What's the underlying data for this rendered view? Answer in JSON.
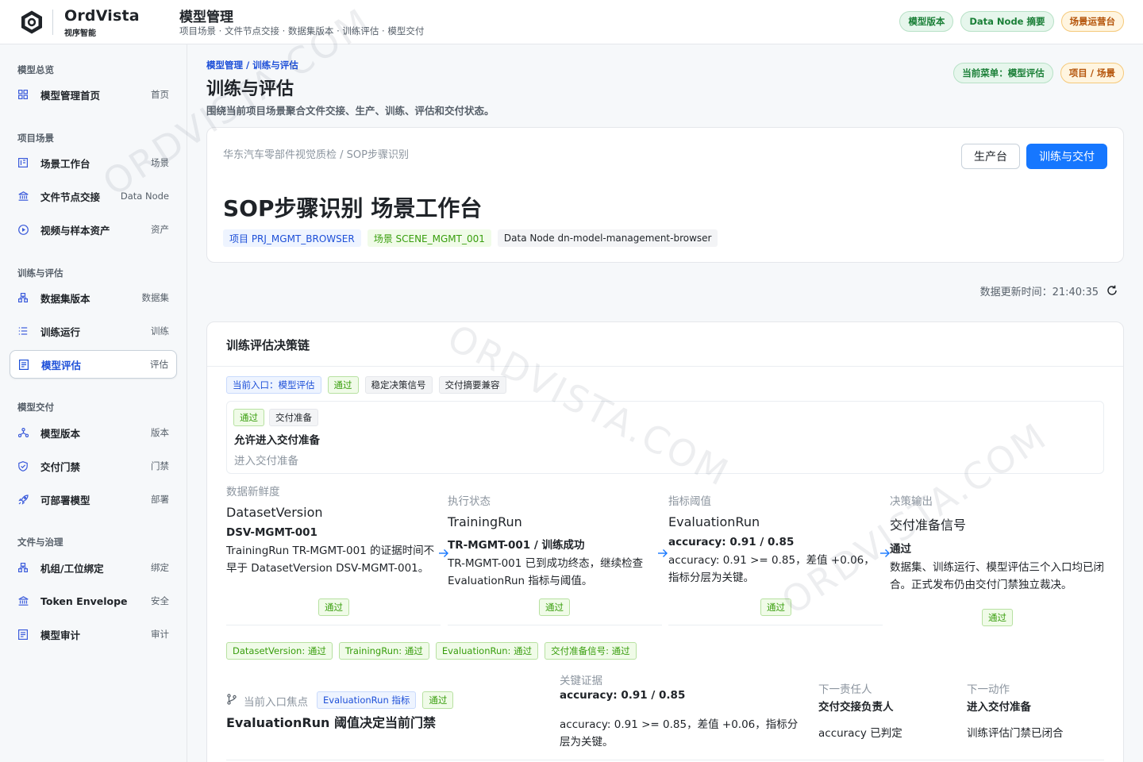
{
  "brand": {
    "name": "OrdVista",
    "subtitle": "视序智能"
  },
  "app": {
    "title": "模型管理",
    "subtitle": "项目场景 · 文件节点交接 · 数据集版本 · 训练评估 · 模型交付"
  },
  "top_pills": [
    "模型版本",
    "Data Node 摘要",
    "场景运营台"
  ],
  "sidebar": {
    "groups": [
      {
        "label": "模型总览",
        "items": [
          {
            "label": "模型管理首页",
            "tag": "首页",
            "icon": "grid-icon"
          }
        ]
      },
      {
        "label": "项目场景",
        "items": [
          {
            "label": "场景工作台",
            "tag": "场景",
            "icon": "workbench-icon"
          },
          {
            "label": "文件节点交接",
            "tag": "Data Node",
            "icon": "bank-icon"
          },
          {
            "label": "视频与样本资产",
            "tag": "资产",
            "icon": "play-circle-icon"
          }
        ]
      },
      {
        "label": "训练与评估",
        "items": [
          {
            "label": "数据集版本",
            "tag": "数据集",
            "icon": "dataset-icon"
          },
          {
            "label": "训练运行",
            "tag": "训练",
            "icon": "list-icon"
          },
          {
            "label": "模型评估",
            "tag": "评估",
            "icon": "evaluation-icon",
            "active": true
          }
        ]
      },
      {
        "label": "模型交付",
        "items": [
          {
            "label": "模型版本",
            "tag": "版本",
            "icon": "cluster-icon"
          },
          {
            "label": "交付门禁",
            "tag": "门禁",
            "icon": "shield-icon"
          },
          {
            "label": "可部署模型",
            "tag": "部署",
            "icon": "rocket-icon"
          }
        ]
      },
      {
        "label": "文件与治理",
        "items": [
          {
            "label": "机组/工位绑定",
            "tag": "绑定",
            "icon": "station-icon"
          },
          {
            "label": "Token Envelope",
            "tag": "安全",
            "icon": "bank-icon"
          },
          {
            "label": "模型审计",
            "tag": "审计",
            "icon": "audit-icon"
          }
        ]
      }
    ]
  },
  "page": {
    "breadcrumb": "模型管理 / 训练与评估",
    "title": "训练与评估",
    "description": "围绕当前项目场景聚合文件交接、生产、训练、评估和交付状态。",
    "pills": [
      "当前菜单：模型评估",
      "项目 / 场景"
    ]
  },
  "scene": {
    "path": "华东汽车零部件视觉质检 / SOP步骤识别",
    "title": "SOP步骤识别 场景工作台",
    "buttons": {
      "production": "生产台",
      "train_deliver": "训练与交付"
    },
    "tags": [
      "项目 PRJ_MGMT_BROWSER",
      "场景 SCENE_MGMT_001",
      "Data Node dn-model-management-browser"
    ]
  },
  "update": {
    "label": "数据更新时间：",
    "time": "21:40:35"
  },
  "chain": {
    "title": "训练评估决策链",
    "chips": [
      "当前入口：模型评估",
      "通过",
      "稳定决策信号",
      "交付摘要兼容"
    ],
    "allow": {
      "chips": [
        "通过",
        "交付准备"
      ],
      "title": "允许进入交付准备",
      "subtitle": "进入交付准备"
    },
    "stages": [
      {
        "label": "数据新鲜度",
        "name": "DatasetVersion",
        "id": "DSV-MGMT-001",
        "desc": "TrainingRun TR-MGMT-001 的证据时间不早于 DatasetVersion DSV-MGMT-001。",
        "status": "通过"
      },
      {
        "label": "执行状态",
        "name": "TrainingRun",
        "id": "TR-MGMT-001 / 训练成功",
        "desc": "TR-MGMT-001 已到成功终态，继续检查 EvaluationRun 指标与阈值。",
        "status": "通过"
      },
      {
        "label": "指标阈值",
        "name": "EvaluationRun",
        "id": "accuracy: 0.91 / 0.85",
        "desc": "accuracy: 0.91 >= 0.85，差值 +0.06，指标分层为关键。",
        "status": "通过"
      },
      {
        "label": "决策输出",
        "name": "交付准备信号",
        "id": "通过",
        "desc": "数据集、训练运行、模型评估三个入口均已闭合。正式发布仍由交付门禁独立裁决。",
        "status": "通过"
      }
    ],
    "summary": [
      "DatasetVersion: 通过",
      "TrainingRun: 通过",
      "EvaluationRun: 通过",
      "交付准备信号: 通过"
    ],
    "focus": {
      "label": "当前入口焦点",
      "chips": [
        "EvaluationRun 指标",
        "通过"
      ],
      "title": "EvaluationRun 阈值决定当前门禁",
      "evidence_label": "关键证据",
      "evidence_value": "accuracy: 0.91 / 0.85",
      "evidence_desc": "accuracy: 0.91 >= 0.85，差值 +0.06，指标分层为关键。",
      "owner_label": "下一责任人",
      "owner_value": "交付交接负责人",
      "owner_desc": "accuracy 已判定",
      "action_label": "下一动作",
      "action_value": "进入交付准备",
      "action_desc": "训练评估门禁已闭合"
    }
  },
  "watermark": "ORDVISTA.COM"
}
